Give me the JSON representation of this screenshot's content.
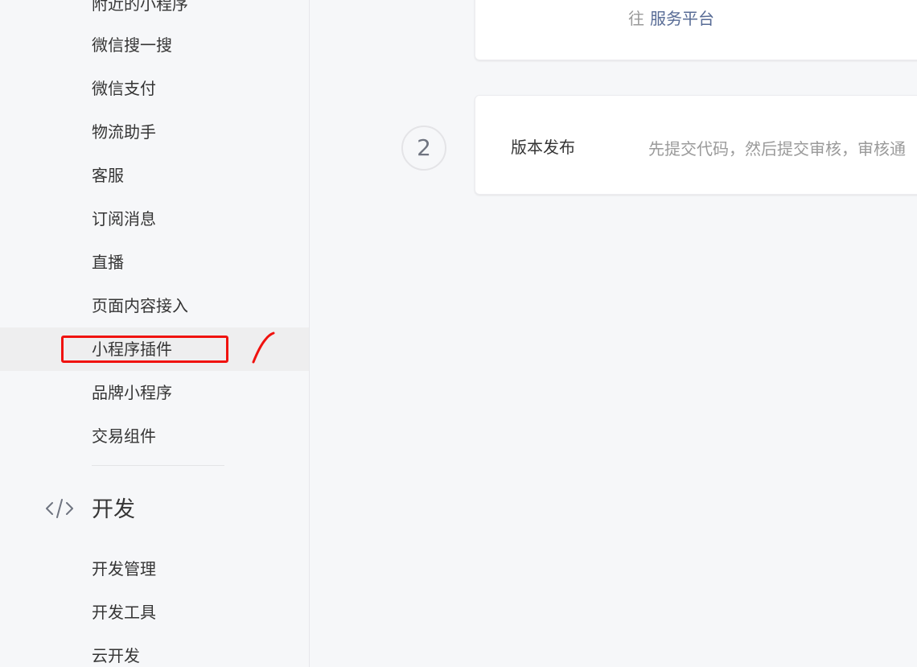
{
  "sidebar": {
    "items": [
      {
        "label": "附近的小程序"
      },
      {
        "label": "微信搜一搜"
      },
      {
        "label": "微信支付"
      },
      {
        "label": "物流助手"
      },
      {
        "label": "客服"
      },
      {
        "label": "订阅消息"
      },
      {
        "label": "直播"
      },
      {
        "label": "页面内容接入"
      },
      {
        "label": "小程序插件"
      },
      {
        "label": "品牌小程序"
      },
      {
        "label": "交易组件"
      }
    ],
    "dev_section": {
      "title": "开发",
      "icon": "code-icon",
      "items": [
        {
          "label": "开发管理"
        },
        {
          "label": "开发工具"
        },
        {
          "label": "云开发"
        }
      ]
    }
  },
  "main": {
    "top_card": {
      "prefix": "往",
      "link": "服务平台"
    },
    "step": {
      "number": "2",
      "title": "版本发布",
      "description": "先提交代码，然后提交审核，审核通"
    }
  },
  "colors": {
    "annotation": "#f0120f",
    "link": "#576b95",
    "sidebar_bg": "#f6f7f9"
  }
}
